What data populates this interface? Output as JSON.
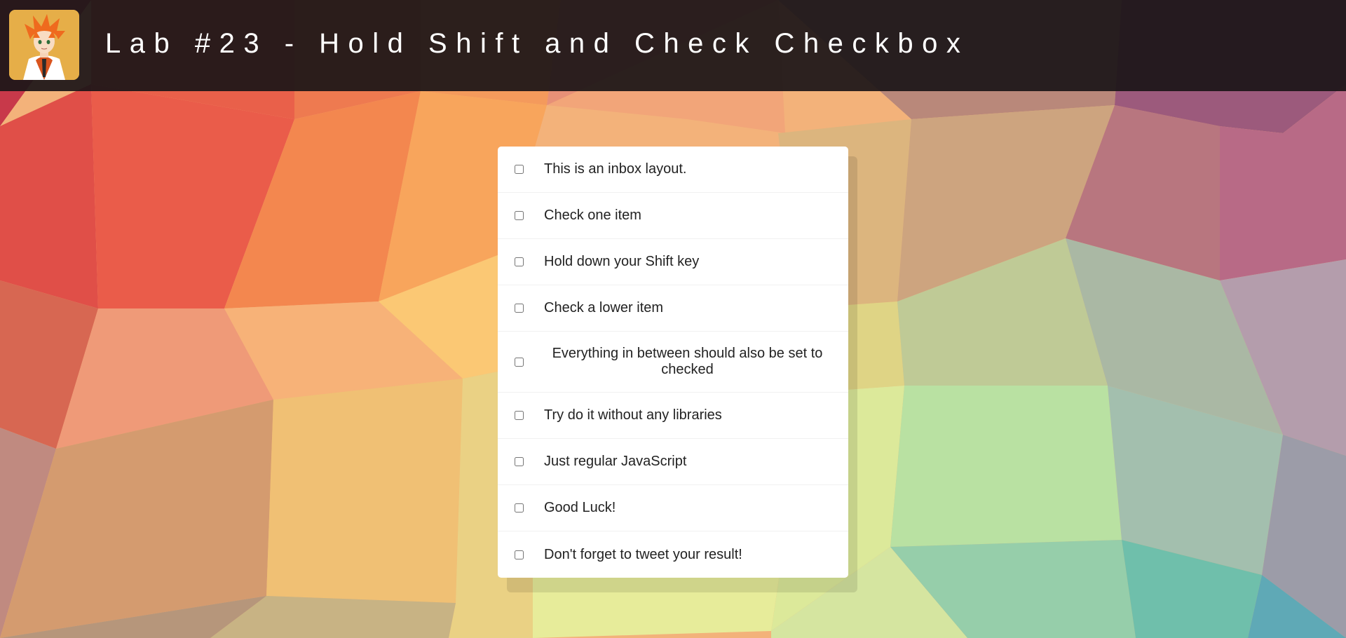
{
  "header": {
    "title": "Lab #23 - Hold Shift and Check Checkbox",
    "avatar_icon": "anime-character-avatar"
  },
  "inbox": {
    "items": [
      {
        "label": "This is an inbox layout.",
        "checked": false
      },
      {
        "label": "Check one item",
        "checked": false
      },
      {
        "label": "Hold down your Shift key",
        "checked": false
      },
      {
        "label": "Check a lower item",
        "checked": false
      },
      {
        "label": "Everything in between should also be set to checked",
        "checked": false
      },
      {
        "label": "Try do it without any libraries",
        "checked": false
      },
      {
        "label": "Just regular JavaScript",
        "checked": false
      },
      {
        "label": "Good Luck!",
        "checked": false
      },
      {
        "label": "Don't forget to tweet your result!",
        "checked": false
      }
    ]
  },
  "colors": {
    "header_bg": "#1c1618",
    "title_text": "#ffffff",
    "card_bg": "#ffffff",
    "item_text": "#222222",
    "avatar_bg": "#e6ae48"
  }
}
